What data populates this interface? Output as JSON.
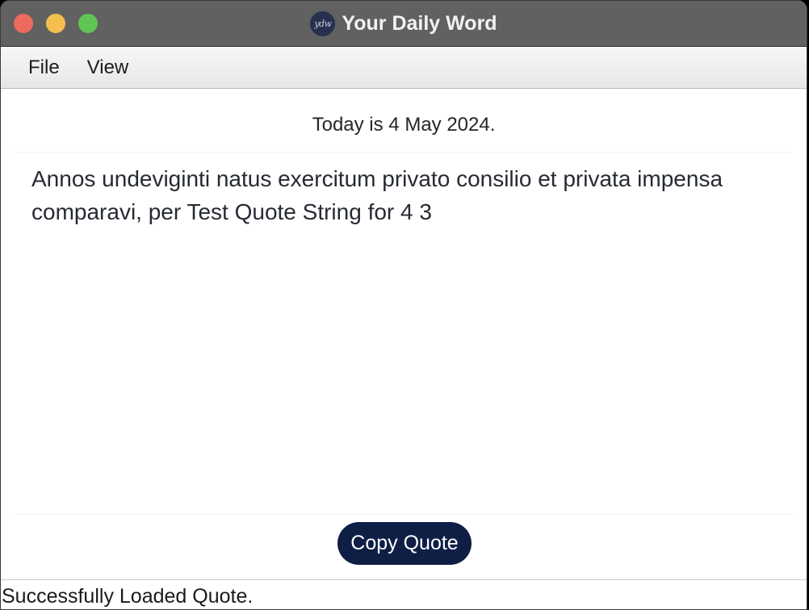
{
  "window": {
    "title": "Your Daily Word",
    "logo_text": "ydw"
  },
  "menu": {
    "items": [
      "File",
      "View"
    ]
  },
  "main": {
    "date_text": "Today is 4 May 2024.",
    "quote_text": "Annos undeviginti natus exercitum privato consilio et privata impensa comparavi, per Test Quote String for 4 3",
    "copy_button_label": "Copy Quote"
  },
  "status": {
    "text": "Successfully Loaded Quote."
  },
  "colors": {
    "titlebar": "#616161",
    "close": "#ec6a5e",
    "minimize": "#f4bf4f",
    "maximize": "#61c554",
    "button": "#0f1e45"
  }
}
